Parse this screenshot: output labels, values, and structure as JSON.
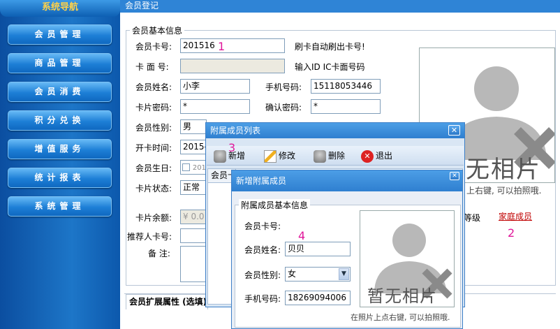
{
  "sidebar": {
    "title": "系统导航",
    "items": [
      {
        "label": "会员管理"
      },
      {
        "label": "商品管理"
      },
      {
        "label": "会员消费"
      },
      {
        "label": "积分兑换"
      },
      {
        "label": "增值服务"
      },
      {
        "label": "统计报表"
      },
      {
        "label": "系统管理"
      }
    ]
  },
  "window": {
    "title": "会员登记"
  },
  "basic": {
    "group_label": "会员基本信息",
    "card_no_label": "会员卡号:",
    "card_no_value": "201516",
    "card_no_hint": "刷卡自动刷出卡号!",
    "card_face_label": "卡 面 号:",
    "card_face_hint": "输入ID IC卡面号码",
    "name_label": "会员姓名:",
    "name_value": "小李",
    "phone_label": "手机号码:",
    "phone_value": "15118053446",
    "pwd_label": "卡片密码:",
    "pwd_value": "*",
    "confirm_label": "确认密码:",
    "confirm_value": "*",
    "gender_label": "会员性别:",
    "gender_value": "男",
    "open_label": "开卡时间:",
    "open_value": "2015-",
    "birth_label": "会员生日:",
    "birth_value": "201",
    "status_label": "卡片状态:",
    "status_value": "正常",
    "balance_label": "卡片余额:",
    "balance_value": "¥ 0.0",
    "referrer_label": "推荐人卡号:",
    "remark_label": "备  注:",
    "level_label": "等级",
    "family_link": "家庭成员",
    "photo_text": "无相片",
    "photo_hint": "上右键, 可以拍照哦.",
    "ext_tab": "会员扩展属性 (选填)"
  },
  "annotations": {
    "n1": "1",
    "n2": "2",
    "n3": "3",
    "n4": "4"
  },
  "member_list": {
    "title": "附属成员列表",
    "close": "✕",
    "btn_add": "新增",
    "btn_edit": "修改",
    "btn_delete": "删除",
    "btn_exit": "退出",
    "header_col": "会员卡"
  },
  "add_member": {
    "title": "新增附属成员",
    "close": "✕",
    "group_label": "附属成员基本信息",
    "card_label": "会员卡号:",
    "name_label": "会员姓名:",
    "name_value": "贝贝",
    "gender_label": "会员性别:",
    "gender_value": "女",
    "phone_label": "手机号码:",
    "phone_value": "18269094006",
    "photo_text": "暂无相片",
    "photo_hint": "在照片上点右键, 可以拍照哦."
  },
  "colors": {
    "accent": "#2f84d6",
    "link": "#c00000",
    "annotation": "#e0179a"
  }
}
